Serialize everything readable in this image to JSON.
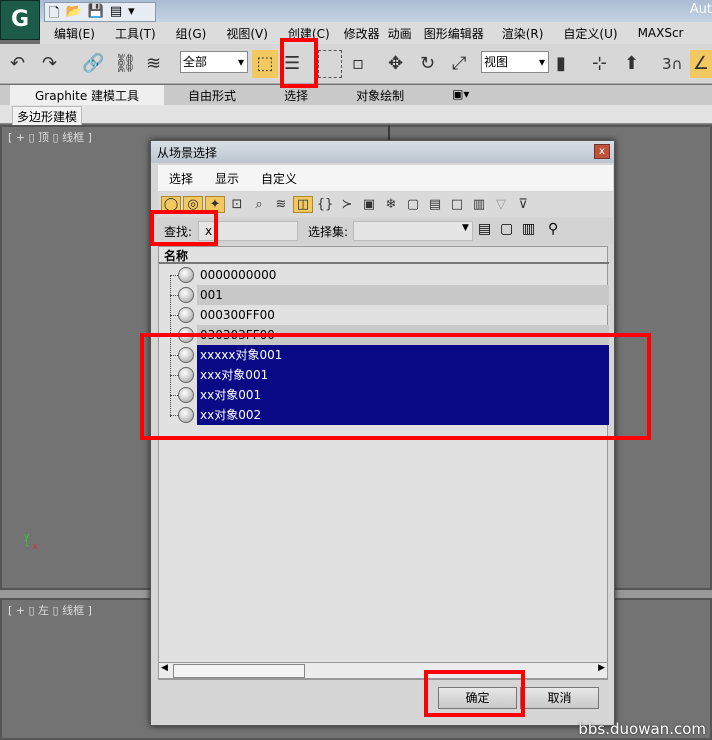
{
  "app": {
    "title": "Aut",
    "logo": "G"
  },
  "menu": [
    "编辑(E)",
    "工具(T)",
    "组(G)",
    "视图(V)",
    "创建(C)",
    "修改器",
    "动画",
    "图形编辑器",
    "渲染(R)",
    "自定义(U)",
    "MAXScr"
  ],
  "toolbar": {
    "selection_filter": "全部",
    "ref_coord": "视图",
    "snap_label": "3"
  },
  "ribbon": {
    "tabs": [
      "Graphite 建模工具",
      "自由形式",
      "选择",
      "对象绘制"
    ],
    "sub_tab": "多边形建模"
  },
  "viewports": {
    "top_label": "[ + ▯ 顶 ▯ 线框 ]",
    "left_label": "[ + ▯ 左 ▯ 线框 ]"
  },
  "dialog": {
    "title": "从场景选择",
    "close": "x",
    "menu": [
      "选择",
      "显示",
      "自定义"
    ],
    "find_label": "查找:",
    "find_value": "x",
    "selset_label": "选择集:",
    "column_header": "名称",
    "items": [
      {
        "name": "0000000000",
        "selected": false
      },
      {
        "name": "001",
        "selected": false
      },
      {
        "name": "000300FF00",
        "selected": false
      },
      {
        "name": "030303FF00",
        "selected": false
      },
      {
        "name": "xxxxx对象001",
        "selected": true
      },
      {
        "name": "xxx对象001",
        "selected": true
      },
      {
        "name": "xx对象001",
        "selected": true
      },
      {
        "name": "xx对象002",
        "selected": true
      }
    ],
    "ok": "确定",
    "cancel": "取消"
  },
  "watermark": "bbs.duowan.com",
  "colors": {
    "selection": "#0a0a86",
    "highlight": "#ff0000"
  }
}
